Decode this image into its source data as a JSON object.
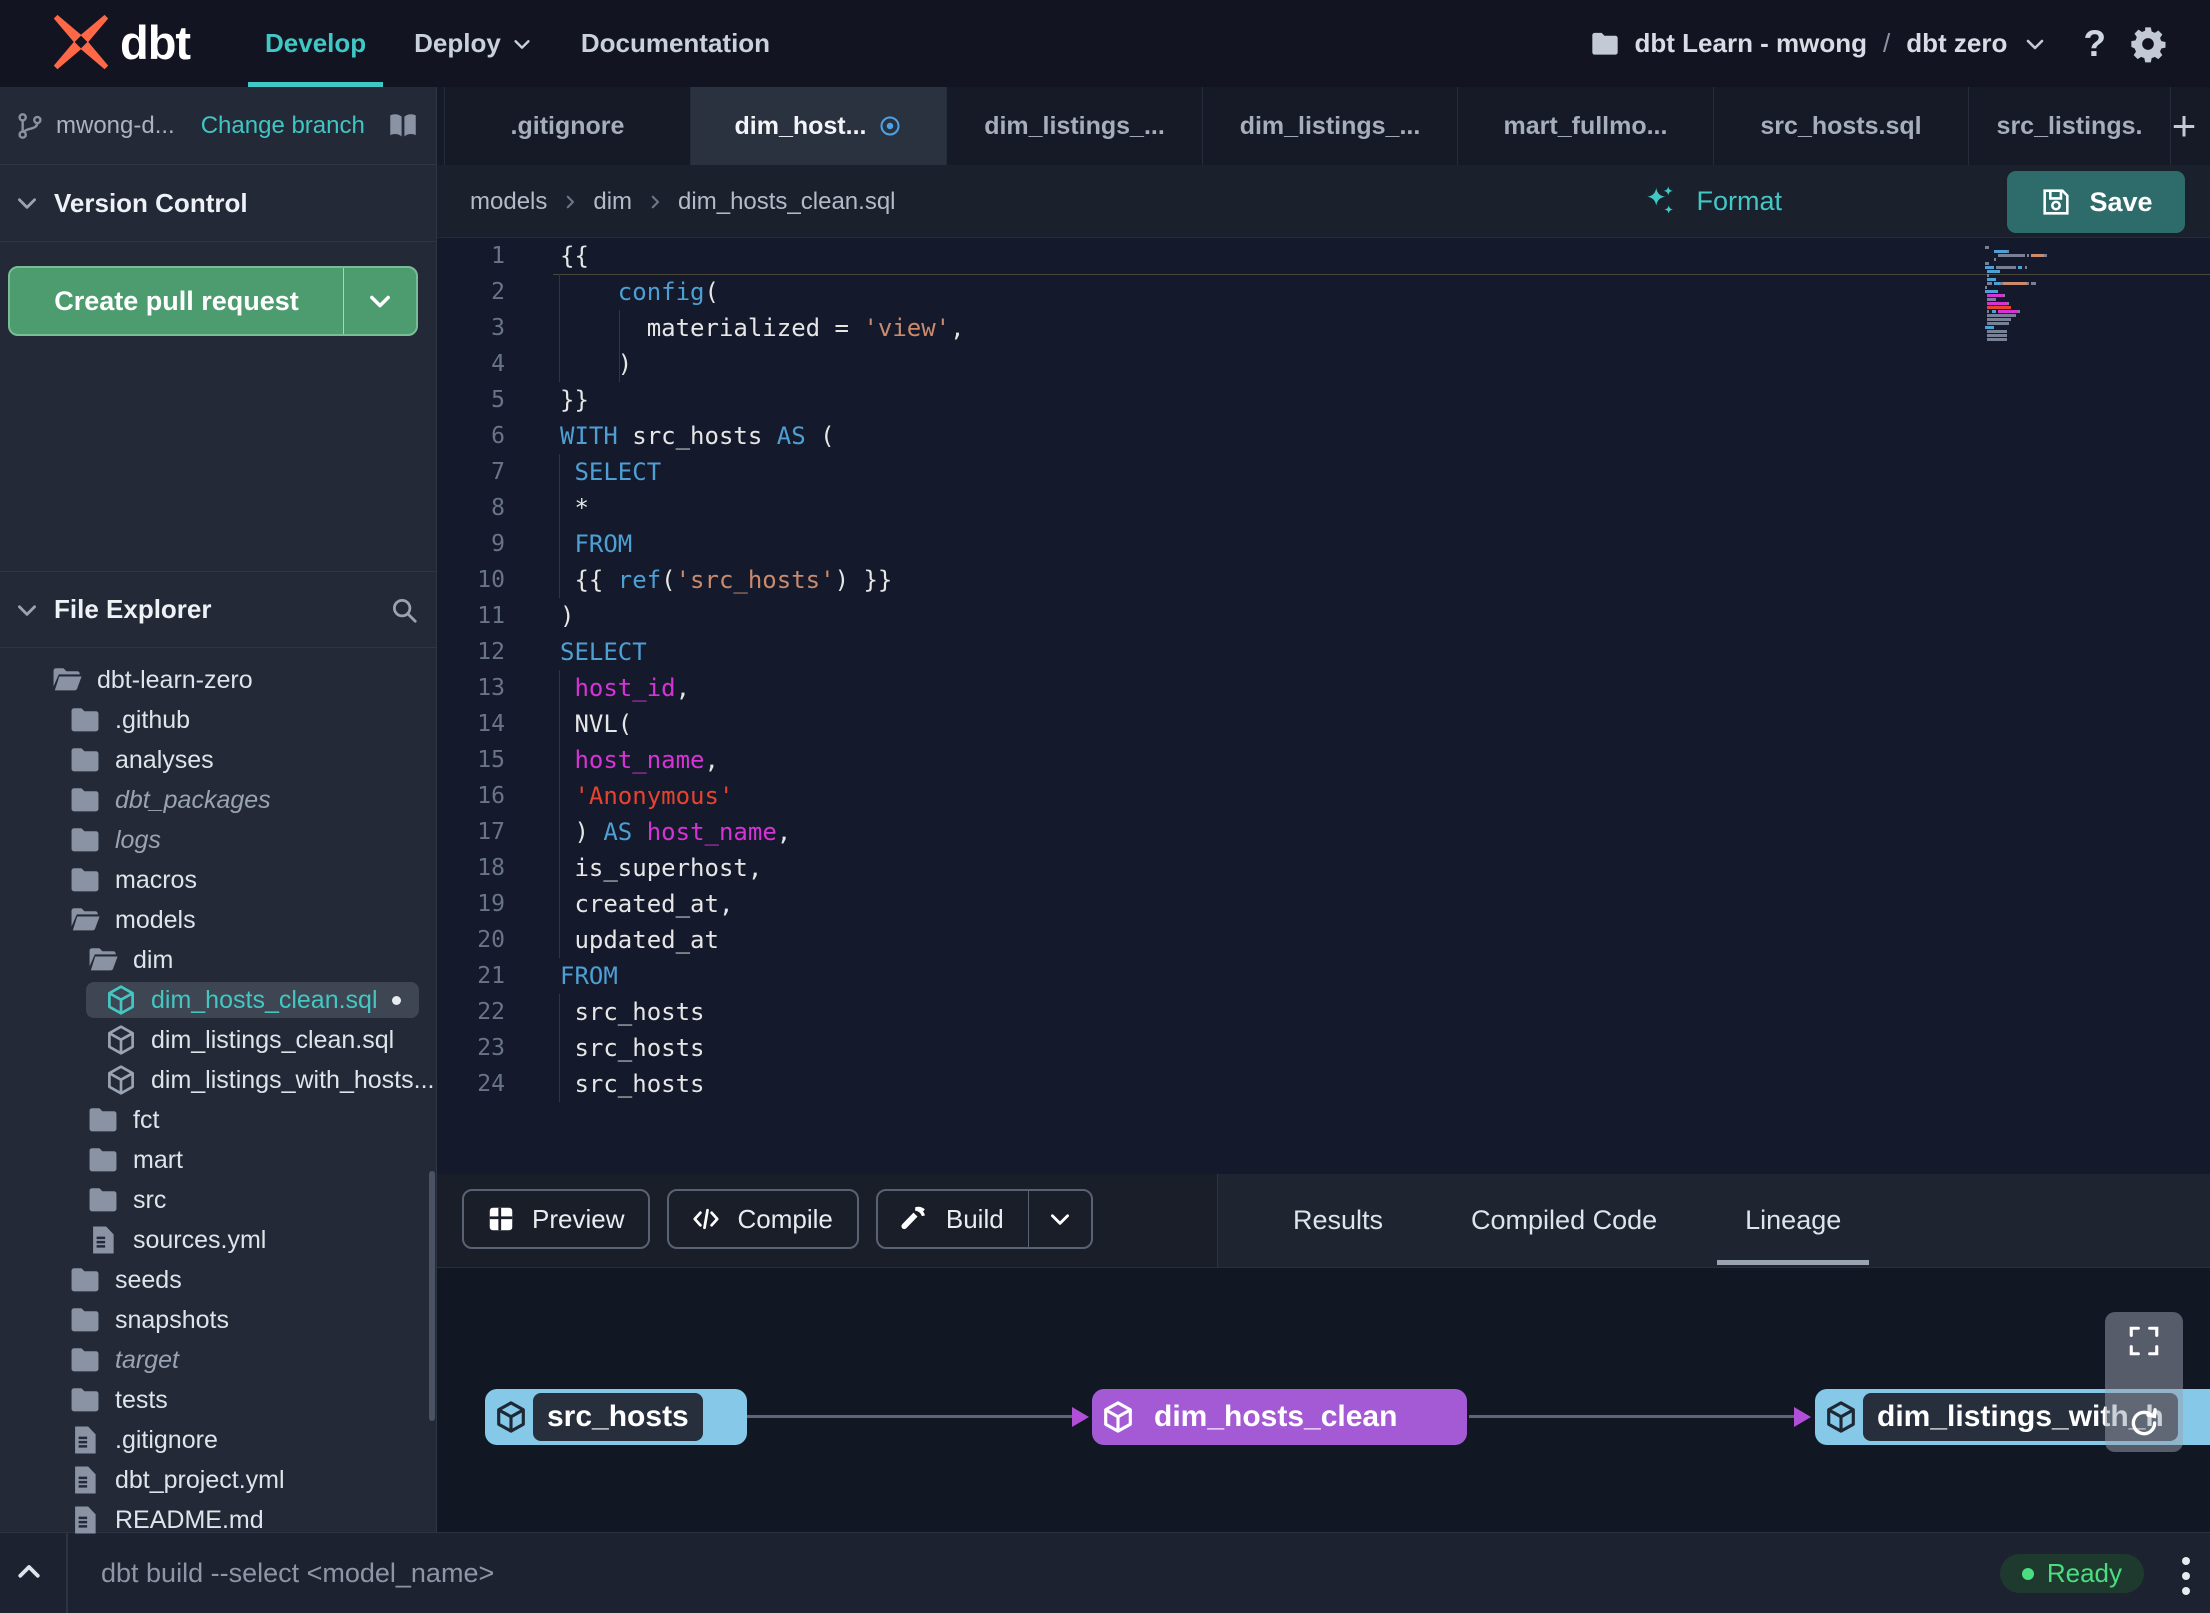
{
  "topbar": {
    "logo": "dbt",
    "nav": [
      {
        "label": "Develop",
        "active": true
      },
      {
        "label": "Deploy",
        "dropdown": true
      },
      {
        "label": "Documentation"
      }
    ],
    "account": "dbt Learn - mwong",
    "separator": "/",
    "project": "dbt zero",
    "help": "?"
  },
  "branch": {
    "name": "mwong-d...",
    "action": "Change branch"
  },
  "tabs": {
    "items": [
      {
        "label": ".gitignore"
      },
      {
        "label": "dim_host...",
        "active": true,
        "dirty": true
      },
      {
        "label": "dim_listings_..."
      },
      {
        "label": "dim_listings_..."
      },
      {
        "label": "mart_fullmo..."
      },
      {
        "label": "src_hosts.sql"
      },
      {
        "label": "src_listings."
      }
    ],
    "add": "+"
  },
  "version_control": {
    "title": "Version Control",
    "button": "Create pull request"
  },
  "file_explorer": {
    "title": "File Explorer",
    "tree": [
      {
        "label": "dbt-learn-zero",
        "icon": "folder-open",
        "level": 0
      },
      {
        "label": ".github",
        "icon": "folder",
        "level": 1
      },
      {
        "label": "analyses",
        "icon": "folder",
        "level": 1
      },
      {
        "label": "dbt_packages",
        "icon": "folder",
        "level": 1,
        "italic": true
      },
      {
        "label": "logs",
        "icon": "folder",
        "level": 1,
        "italic": true
      },
      {
        "label": "macros",
        "icon": "folder",
        "level": 1
      },
      {
        "label": "models",
        "icon": "folder-open",
        "level": 1
      },
      {
        "label": "dim",
        "icon": "folder-open",
        "level": 2
      },
      {
        "label": "dim_hosts_clean.sql",
        "icon": "cube",
        "level": 3,
        "selected": true,
        "dot": true
      },
      {
        "label": "dim_listings_clean.sql",
        "icon": "cube",
        "level": 3
      },
      {
        "label": "dim_listings_with_hosts...",
        "icon": "cube",
        "level": 3
      },
      {
        "label": "fct",
        "icon": "folder",
        "level": 2
      },
      {
        "label": "mart",
        "icon": "folder",
        "level": 2
      },
      {
        "label": "src",
        "icon": "folder",
        "level": 2
      },
      {
        "label": "sources.yml",
        "icon": "file",
        "level": 2
      },
      {
        "label": "seeds",
        "icon": "folder",
        "level": 1
      },
      {
        "label": "snapshots",
        "icon": "folder",
        "level": 1
      },
      {
        "label": "target",
        "icon": "folder",
        "level": 1,
        "italic": true
      },
      {
        "label": "tests",
        "icon": "folder",
        "level": 1
      },
      {
        "label": ".gitignore",
        "icon": "file",
        "level": 1
      },
      {
        "label": "dbt_project.yml",
        "icon": "file",
        "level": 1
      },
      {
        "label": "README.md",
        "icon": "file",
        "level": 1
      }
    ]
  },
  "editor": {
    "breadcrumb": [
      "models",
      "dim",
      "dim_hosts_clean.sql"
    ],
    "actions": {
      "format": "Format",
      "save": "Save"
    },
    "code": {
      "lines": [
        {
          "cur": true,
          "seg": [
            [
              "p",
              "{{"
            ]
          ]
        },
        {
          "g": [
            0
          ],
          "seg": [
            [
              "p",
              "    "
            ],
            [
              "b",
              "config"
            ],
            [
              "p",
              "("
            ]
          ]
        },
        {
          "g": [
            0,
            1
          ],
          "seg": [
            [
              "p",
              "      materialized = "
            ],
            [
              "s",
              "'view'"
            ],
            [
              "p",
              ","
            ]
          ]
        },
        {
          "g": [
            0,
            1
          ],
          "seg": [
            [
              "p",
              "    )"
            ]
          ]
        },
        {
          "seg": [
            [
              "p",
              "}}"
            ]
          ]
        },
        {
          "seg": [
            [
              "b",
              "WITH"
            ],
            [
              "p",
              " src_hosts "
            ],
            [
              "b",
              "AS"
            ],
            [
              "p",
              " ("
            ]
          ]
        },
        {
          "g": [
            0
          ],
          "seg": [
            [
              "p",
              " "
            ],
            [
              "b",
              "SELECT"
            ]
          ]
        },
        {
          "g": [
            0
          ],
          "seg": [
            [
              "p",
              " *"
            ]
          ]
        },
        {
          "g": [
            0
          ],
          "seg": [
            [
              "p",
              " "
            ],
            [
              "b",
              "FROM"
            ]
          ]
        },
        {
          "g": [
            0
          ],
          "seg": [
            [
              "p",
              " {{ "
            ],
            [
              "b",
              "ref"
            ],
            [
              "p",
              "("
            ],
            [
              "s",
              "'src_hosts'"
            ],
            [
              "p",
              ") }}"
            ]
          ]
        },
        {
          "seg": [
            [
              "p",
              ")"
            ]
          ]
        },
        {
          "seg": [
            [
              "b",
              "SELECT"
            ]
          ]
        },
        {
          "g": [
            0
          ],
          "seg": [
            [
              "p",
              " "
            ],
            [
              "m",
              "host_id"
            ],
            [
              "p",
              ","
            ]
          ]
        },
        {
          "g": [
            0
          ],
          "seg": [
            [
              "p",
              " NVL("
            ]
          ]
        },
        {
          "g": [
            0
          ],
          "seg": [
            [
              "p",
              " "
            ],
            [
              "m",
              "host_name"
            ],
            [
              "p",
              ","
            ]
          ]
        },
        {
          "g": [
            0
          ],
          "seg": [
            [
              "p",
              " "
            ],
            [
              "r",
              "'Anonymous'"
            ]
          ]
        },
        {
          "g": [
            0
          ],
          "seg": [
            [
              "p",
              " ) "
            ],
            [
              "b",
              "AS"
            ],
            [
              "p",
              " "
            ],
            [
              "m",
              "host_name"
            ],
            [
              "p",
              ","
            ]
          ]
        },
        {
          "g": [
            0
          ],
          "seg": [
            [
              "p",
              " is_superhost,"
            ]
          ]
        },
        {
          "g": [
            0
          ],
          "seg": [
            [
              "p",
              " created_at,"
            ]
          ]
        },
        {
          "g": [
            0
          ],
          "seg": [
            [
              "p",
              " updated_at"
            ]
          ]
        },
        {
          "seg": [
            [
              "b",
              "FROM"
            ]
          ]
        },
        {
          "g": [
            0
          ],
          "seg": [
            [
              "p",
              " src_hosts"
            ]
          ]
        },
        {
          "g": [
            0
          ],
          "seg": [
            [
              "p",
              " src_hosts"
            ]
          ]
        },
        {
          "g": [
            0
          ],
          "seg": [
            [
              "p",
              " src_hosts"
            ]
          ]
        }
      ]
    }
  },
  "panel": {
    "actions": [
      {
        "label": "Preview",
        "icon": "grid-icon"
      },
      {
        "label": "Compile",
        "icon": "code-icon"
      },
      {
        "label": "Build",
        "icon": "hammer-icon",
        "split": true
      }
    ],
    "tabs": [
      {
        "label": "Results"
      },
      {
        "label": "Compiled Code"
      },
      {
        "label": "Lineage",
        "active": true
      }
    ]
  },
  "lineage": {
    "nodes": [
      {
        "label": "src_hosts",
        "variant": "blue"
      },
      {
        "label": "dim_hosts_clean",
        "variant": "purple"
      },
      {
        "label": "dim_listings_with_h",
        "variant": "blue"
      }
    ]
  },
  "statusbar": {
    "command": "dbt build --select <model_name>",
    "status": "Ready"
  },
  "colors": {
    "accent_teal": "#41c8c5",
    "green_button": "#4c9c6f",
    "save_teal": "#2e6c6b",
    "lineage_blue": "#85c8e8",
    "lineage_purple": "#a55ad5",
    "ready_green": "#4ade80",
    "dirty_blue": "#4da3e8",
    "code_keyword": "#4e9fd4",
    "code_string": "#c98a6d",
    "code_string_red": "#e8432e",
    "code_column": "#d633d6"
  }
}
